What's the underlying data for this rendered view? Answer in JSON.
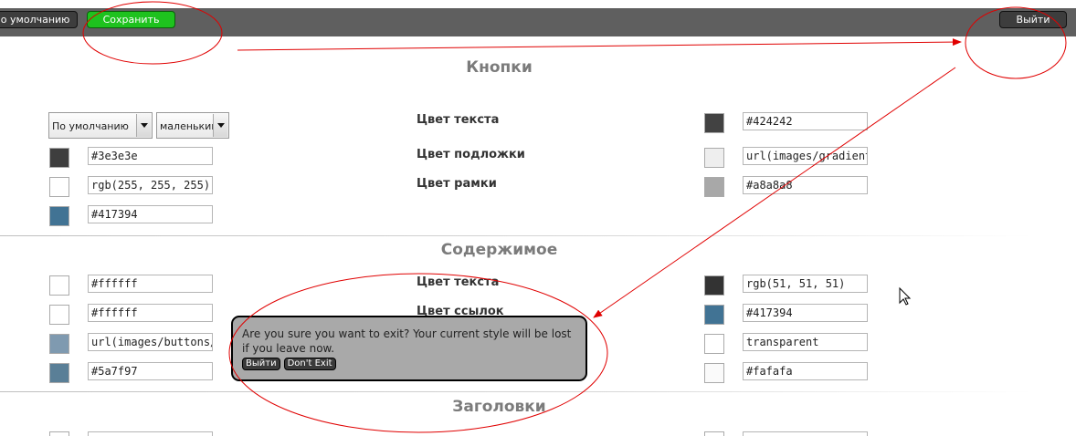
{
  "toolbar": {
    "default_label": "По умолчанию",
    "save_label": "Сохранить",
    "exit_label": "Выйти"
  },
  "sections": {
    "buttons_title": "Кнопки",
    "content_title": "Содержимое",
    "headings_title": "Заголовки"
  },
  "buttons": {
    "font_select": "По умолчанию",
    "size_select": "маленький",
    "label_text_color": "Цвет текста",
    "label_bg": "Цвет подложки",
    "label_border": "Цвет рамки",
    "left": [
      {
        "color": "#3e3e3e",
        "value": "#3e3e3e"
      },
      {
        "color": "#ffffff",
        "value": "rgb(255, 255, 255)"
      },
      {
        "color": "#417394",
        "value": "#417394"
      }
    ],
    "right": [
      {
        "color": "#424242",
        "value": "#424242"
      },
      {
        "color": "#eeeeee",
        "value": "url(images/gradients/g"
      },
      {
        "color": "#a8a8a8",
        "value": "#a8a8a8"
      }
    ]
  },
  "content": {
    "label_text_color": "Цвет текста",
    "label_links": "Цвет ссылок",
    "left": [
      {
        "color": "#ffffff",
        "value": "#ffffff"
      },
      {
        "color": "#ffffff",
        "value": "#ffffff"
      },
      {
        "color": "#7f9ab0",
        "value": "url(images/buttons/nev"
      },
      {
        "color": "#5a7f97",
        "value": "#5a7f97"
      }
    ],
    "right": [
      {
        "color": "#333333",
        "value": "rgb(51, 51, 51)"
      },
      {
        "color": "#417394",
        "value": "#417394"
      },
      {
        "color": "#ffffff",
        "value": "transparent"
      },
      {
        "color": "#fafafa",
        "value": "#fafafa"
      }
    ]
  },
  "dialog": {
    "message": "Are you sure you want to exit? Your current style will be lost if you leave now.",
    "exit_label": "Выйти",
    "dont_exit_label": "Don't Exit"
  },
  "colors": {
    "toolbar_bg": "#5f5f5f",
    "save_green": "#1ec21e",
    "annotation_red": "#e00000",
    "dialog_bg": "#a9a9a9"
  }
}
